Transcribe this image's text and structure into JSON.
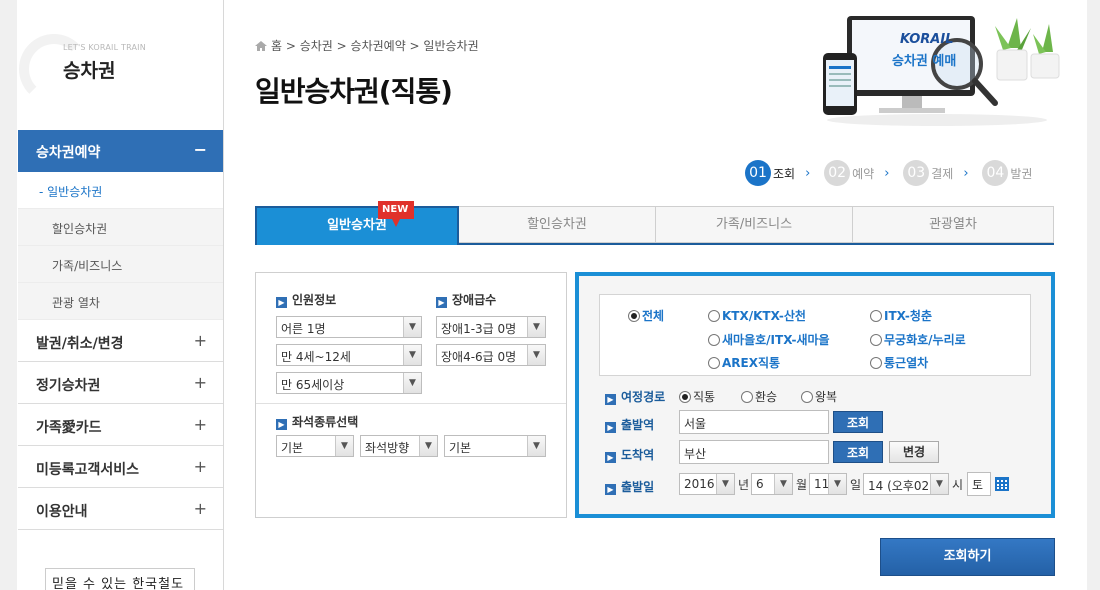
{
  "sidebar": {
    "brand_sub": "LET'S KORAIL TRAIN",
    "brand_title": "승차권",
    "active_menu": {
      "label": "승차권예약",
      "sign": "−"
    },
    "submenu": [
      "- 일반승차권",
      "할인승차권",
      "가족/비즈니스",
      "관광 열차"
    ],
    "menu": [
      {
        "label": "발권/취소/변경",
        "sign": "+"
      },
      {
        "label": "정기승차권",
        "sign": "+"
      },
      {
        "label": "가족愛카드",
        "sign": "+"
      },
      {
        "label": "미등록고객서비스",
        "sign": "+"
      },
      {
        "label": "이용안내",
        "sign": "+"
      }
    ],
    "slogan": "믿을 수 있는 한국철도"
  },
  "breadcrumb": "홈 > 승차권 > 승차권예약 > 일반승차권",
  "page_title": "일반승차권(직통)",
  "banner": {
    "logo": "KORAIL",
    "text": "승차권 예매"
  },
  "steps": [
    {
      "num": "01",
      "label": "조회",
      "active": true
    },
    {
      "num": "02",
      "label": "예약",
      "active": false
    },
    {
      "num": "03",
      "label": "결제",
      "active": false
    },
    {
      "num": "04",
      "label": "발권",
      "active": false
    }
  ],
  "tabs": [
    "일반승차권",
    "할인승차권",
    "가족/비즈니스",
    "관광열차"
  ],
  "new_badge": "NEW",
  "passenger": {
    "label": "인원정보",
    "adult": "어른 1명",
    "child": "만 4세~12세",
    "senior": "만 65세이상"
  },
  "disability": {
    "label": "장애급수",
    "grade13": "장애1-3급 0명",
    "grade46": "장애4-6급 0명"
  },
  "seat": {
    "label": "좌석종류선택",
    "type": "기본",
    "direction": "좌석방향",
    "option": "기본"
  },
  "train_types": [
    {
      "label": "전체",
      "checked": true
    },
    {
      "label": "KTX/KTX-산천",
      "checked": false
    },
    {
      "label": "ITX-청춘",
      "checked": false
    },
    {
      "label": "새마을호/ITX-새마을",
      "checked": false
    },
    {
      "label": "무궁화호/누리로",
      "checked": false
    },
    {
      "label": "AREX직통",
      "checked": false
    },
    {
      "label": "통근열차",
      "checked": false
    }
  ],
  "route": {
    "label": "여정경로",
    "options": [
      {
        "label": "직통",
        "checked": true
      },
      {
        "label": "환승",
        "checked": false
      },
      {
        "label": "왕복",
        "checked": false
      }
    ]
  },
  "departure": {
    "label": "출발역",
    "value": "서울",
    "button": "조회"
  },
  "arrival": {
    "label": "도착역",
    "value": "부산",
    "button": "조회",
    "swap": "변경"
  },
  "date": {
    "label": "출발일",
    "year": "2016",
    "year_unit": "년",
    "month": "6",
    "month_unit": "월",
    "day": "11",
    "day_unit": "일",
    "hour": "14 (오후02)",
    "hour_unit": "시",
    "weekday": "토"
  },
  "search_button": "조회하기",
  "colors": {
    "primary": "#1b8fd6",
    "accent": "#2f6fb5",
    "badge": "#e0312b"
  }
}
